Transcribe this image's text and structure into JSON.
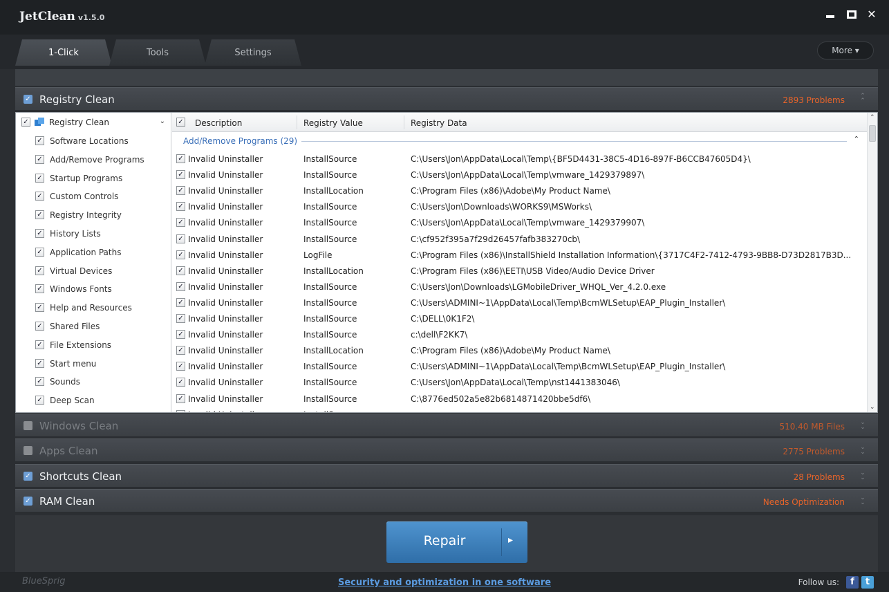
{
  "app": {
    "title": "JetClean",
    "version": "v1.5.0"
  },
  "tabs": [
    {
      "label": "1-Click",
      "active": true
    },
    {
      "label": "Tools",
      "active": false
    },
    {
      "label": "Settings",
      "active": false
    }
  ],
  "more_label": "More ▾",
  "sections": {
    "registry": {
      "name": "Registry Clean",
      "status": "2893  Problems",
      "checked": true
    },
    "windows": {
      "name": "Windows Clean",
      "status": "510.40 MB  Files",
      "checked": false
    },
    "apps": {
      "name": "Apps Clean",
      "status": "2775  Problems",
      "checked": false
    },
    "shortcuts": {
      "name": "Shortcuts Clean",
      "status": "28  Problems",
      "checked": true
    },
    "ram": {
      "name": "RAM Clean",
      "status": "Needs Optimization",
      "checked": true
    }
  },
  "left_list": {
    "root_label": "Registry Clean",
    "items": [
      "Software Locations",
      "Add/Remove Programs",
      "Startup Programs",
      "Custom Controls",
      "Registry Integrity",
      "History Lists",
      "Application Paths",
      "Virtual Devices",
      "Windows Fonts",
      "Help and Resources",
      "Shared Files",
      "File Extensions",
      "Start menu",
      "Sounds",
      "Deep Scan"
    ]
  },
  "grid": {
    "headers": {
      "description": "Description",
      "value": "Registry Value",
      "data": "Registry Data"
    },
    "group_label": "Add/Remove Programs (29)",
    "rows": [
      {
        "d": "Invalid Uninstaller",
        "v": "InstallSource",
        "r": "C:\\Users\\Jon\\AppData\\Local\\Temp\\{BF5D4431-38C5-4D16-897F-B6CCB47605D4}\\"
      },
      {
        "d": "Invalid Uninstaller",
        "v": "InstallSource",
        "r": "C:\\Users\\Jon\\AppData\\Local\\Temp\\vmware_1429379897\\"
      },
      {
        "d": "Invalid Uninstaller",
        "v": "InstallLocation",
        "r": "C:\\Program Files (x86)\\Adobe\\My Product Name\\"
      },
      {
        "d": "Invalid Uninstaller",
        "v": "InstallSource",
        "r": "C:\\Users\\Jon\\Downloads\\WORKS9\\MSWorks\\"
      },
      {
        "d": "Invalid Uninstaller",
        "v": "InstallSource",
        "r": "C:\\Users\\Jon\\AppData\\Local\\Temp\\vmware_1429379907\\"
      },
      {
        "d": "Invalid Uninstaller",
        "v": "InstallSource",
        "r": "C:\\cf952f395a7f29d26457fafb383270cb\\"
      },
      {
        "d": "Invalid Uninstaller",
        "v": "LogFile",
        "r": "C:\\Program Files (x86)\\InstallShield Installation Information\\{3717C4F2-7412-4793-9BB8-D73D2817B3D..."
      },
      {
        "d": "Invalid Uninstaller",
        "v": "InstallLocation",
        "r": "C:\\Program Files (x86)\\EETI\\USB Video/Audio Device Driver"
      },
      {
        "d": "Invalid Uninstaller",
        "v": "InstallSource",
        "r": "C:\\Users\\Jon\\Downloads\\LGMobileDriver_WHQL_Ver_4.2.0.exe"
      },
      {
        "d": "Invalid Uninstaller",
        "v": "InstallSource",
        "r": "C:\\Users\\ADMINI~1\\AppData\\Local\\Temp\\BcmWLSetup\\EAP_Plugin_Installer\\"
      },
      {
        "d": "Invalid Uninstaller",
        "v": "InstallSource",
        "r": "C:\\DELL\\0K1F2\\"
      },
      {
        "d": "Invalid Uninstaller",
        "v": "InstallSource",
        "r": "c:\\dell\\F2KK7\\"
      },
      {
        "d": "Invalid Uninstaller",
        "v": "InstallLocation",
        "r": "C:\\Program Files (x86)\\Adobe\\My Product Name\\"
      },
      {
        "d": "Invalid Uninstaller",
        "v": "InstallSource",
        "r": "C:\\Users\\ADMINI~1\\AppData\\Local\\Temp\\BcmWLSetup\\EAP_Plugin_Installer\\"
      },
      {
        "d": "Invalid Uninstaller",
        "v": "InstallSource",
        "r": "C:\\Users\\Jon\\AppData\\Local\\Temp\\nst1441383046\\"
      },
      {
        "d": "Invalid Uninstaller",
        "v": "InstallSource",
        "r": "C:\\8776ed502a5e82b6814871420bbe5df6\\"
      },
      {
        "d": "Invalid Uninstaller",
        "v": "InstallSource",
        "r": ""
      }
    ]
  },
  "repair_label": "Repair",
  "footer": {
    "brand": "BlueSprig",
    "slogan": "Security and optimization in one software",
    "follow": "Follow us:"
  },
  "colors": {
    "accent": "#4a8fcc",
    "status": "#e8642a",
    "link": "#5b9be0"
  },
  "icons": [
    "minimize-icon",
    "maximize-icon",
    "close-icon",
    "registry-icon",
    "facebook-icon",
    "twitter-icon"
  ]
}
